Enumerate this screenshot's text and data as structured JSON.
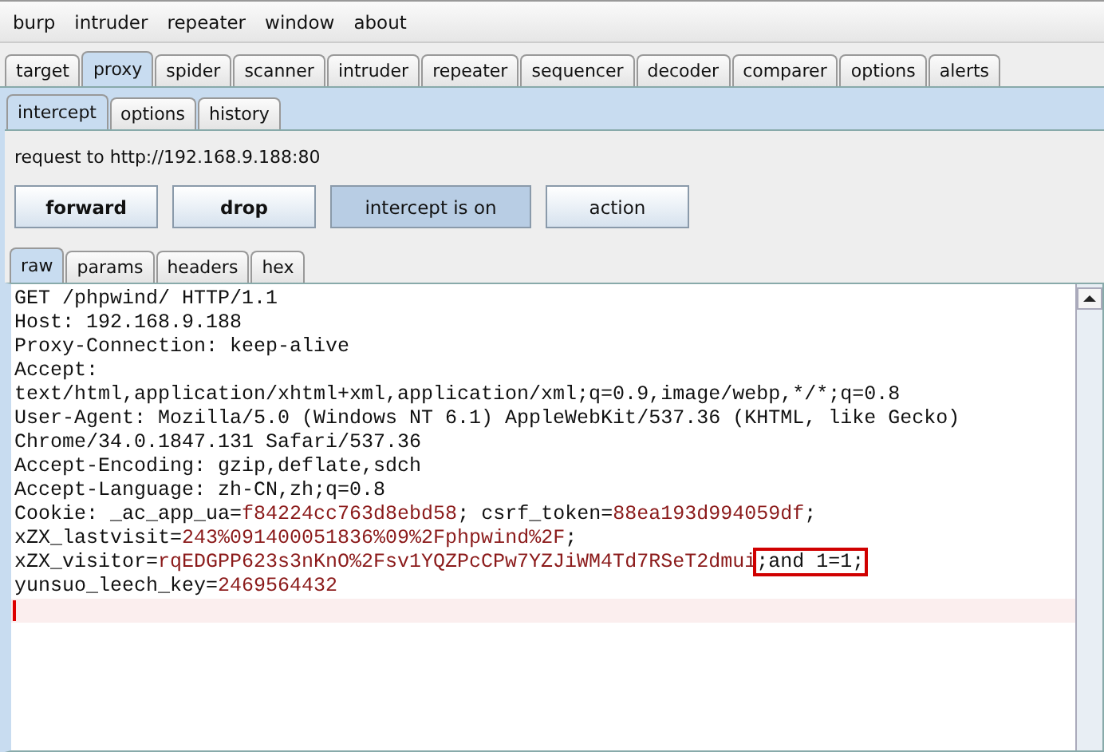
{
  "menu_bar": [
    "burp",
    "intruder",
    "repeater",
    "window",
    "about"
  ],
  "tabs": [
    {
      "label": "target",
      "selected": false
    },
    {
      "label": "proxy",
      "selected": true
    },
    {
      "label": "spider",
      "selected": false
    },
    {
      "label": "scanner",
      "selected": false
    },
    {
      "label": "intruder",
      "selected": false
    },
    {
      "label": "repeater",
      "selected": false
    },
    {
      "label": "sequencer",
      "selected": false
    },
    {
      "label": "decoder",
      "selected": false
    },
    {
      "label": "comparer",
      "selected": false
    },
    {
      "label": "options",
      "selected": false
    },
    {
      "label": "alerts",
      "selected": false
    }
  ],
  "sub_tabs": [
    {
      "label": "intercept",
      "selected": true
    },
    {
      "label": "options",
      "selected": false
    },
    {
      "label": "history",
      "selected": false
    }
  ],
  "request_label": "request to http://192.168.9.188:80",
  "buttons": [
    {
      "label": "forward",
      "bold": true,
      "on": false
    },
    {
      "label": "drop",
      "bold": true,
      "on": false
    },
    {
      "label": "intercept is on",
      "bold": false,
      "on": true
    },
    {
      "label": "action",
      "bold": false,
      "on": false
    }
  ],
  "editor_tabs": [
    {
      "label": "raw",
      "selected": true
    },
    {
      "label": "params",
      "selected": false
    },
    {
      "label": "headers",
      "selected": false
    },
    {
      "label": "hex",
      "selected": false
    }
  ],
  "editor_lines": [
    [
      {
        "kind": "plain",
        "text": "GET /phpwind/ HTTP/1.1"
      }
    ],
    [
      {
        "kind": "plain",
        "text": "Host: 192.168.9.188"
      }
    ],
    [
      {
        "kind": "plain",
        "text": "Proxy-Connection: keep-alive"
      }
    ],
    [
      {
        "kind": "plain",
        "text": "Accept:"
      }
    ],
    [
      {
        "kind": "plain",
        "text": "text/html,application/xhtml+xml,application/xml;q=0.9,image/webp,*/*;q=0.8"
      }
    ],
    [
      {
        "kind": "plain",
        "text": "User-Agent: Mozilla/5.0 (Windows NT 6.1) AppleWebKit/537.36 (KHTML, like Gecko)"
      }
    ],
    [
      {
        "kind": "plain",
        "text": "Chrome/34.0.1847.131 Safari/537.36"
      }
    ],
    [
      {
        "kind": "plain",
        "text": "Accept-Encoding: gzip,deflate,sdch"
      }
    ],
    [
      {
        "kind": "plain",
        "text": "Accept-Language: zh-CN,zh;q=0.8"
      }
    ],
    [
      {
        "kind": "plain",
        "text": "Cookie: _ac_app_ua="
      },
      {
        "kind": "value",
        "text": "f84224cc763d8ebd58"
      },
      {
        "kind": "plain",
        "text": "; csrf_token="
      },
      {
        "kind": "value",
        "text": "88ea193d994059df"
      },
      {
        "kind": "plain",
        "text": ";"
      }
    ],
    [
      {
        "kind": "plain",
        "text": "xZX_lastvisit="
      },
      {
        "kind": "value",
        "text": "243%091400051836%09%2Fphpwind%2F"
      },
      {
        "kind": "plain",
        "text": ";"
      }
    ],
    [
      {
        "kind": "plain",
        "text": "xZX_visitor="
      },
      {
        "kind": "value",
        "text": "rqEDGPP623s3nKnO%2Fsv1YQZPcCPw7YZJiWM4Td7RSeT2dmui"
      },
      {
        "kind": "marked",
        "text": ";and 1=1;"
      }
    ],
    [
      {
        "kind": "plain",
        "text": "yunsuo_leech_key="
      },
      {
        "kind": "value",
        "text": "2469564432"
      }
    ]
  ]
}
